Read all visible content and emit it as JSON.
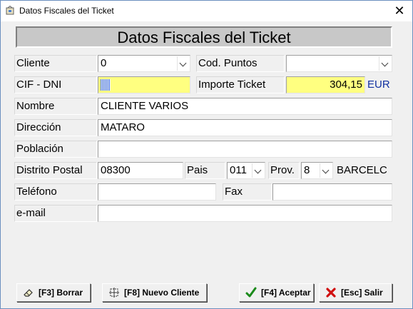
{
  "window": {
    "title": "Datos Fiscales del Ticket",
    "close_glyph": "✕"
  },
  "banner": {
    "title": "Datos Fiscales del Ticket"
  },
  "form": {
    "cliente": {
      "label": "Cliente",
      "value": "0"
    },
    "cod_puntos": {
      "label": "Cod. Puntos",
      "value": ""
    },
    "cif_dni": {
      "label": "CIF - DNI",
      "value": ""
    },
    "importe": {
      "label": "Importe Ticket",
      "value": "304,15",
      "currency": "EUR"
    },
    "nombre": {
      "label": "Nombre",
      "value": "CLIENTE VARIOS"
    },
    "direccion": {
      "label": "Dirección",
      "value": "MATARO"
    },
    "poblacion": {
      "label": "Población",
      "value": ""
    },
    "distrito_postal": {
      "label": "Distrito Postal",
      "value": "08300"
    },
    "pais": {
      "label": "Pais",
      "value": "011"
    },
    "prov": {
      "label": "Prov.",
      "value": "8",
      "name": "BARCELC"
    },
    "telefono": {
      "label": "Teléfono",
      "value": ""
    },
    "fax": {
      "label": "Fax",
      "value": ""
    },
    "email": {
      "label": "e-mail",
      "value": ""
    }
  },
  "buttons": {
    "borrar": {
      "label": "[F3] Borrar",
      "icon": "eraser-icon"
    },
    "nuevo_cliente": {
      "label": "[F8] Nuevo Cliente",
      "icon": "new-client-icon"
    },
    "aceptar": {
      "label": "[F4] Aceptar",
      "icon": "checkmark-icon",
      "color": "#1a8a1a"
    },
    "salir": {
      "label": "[Esc] Salir",
      "icon": "red-x-icon",
      "color": "#d01010"
    }
  }
}
